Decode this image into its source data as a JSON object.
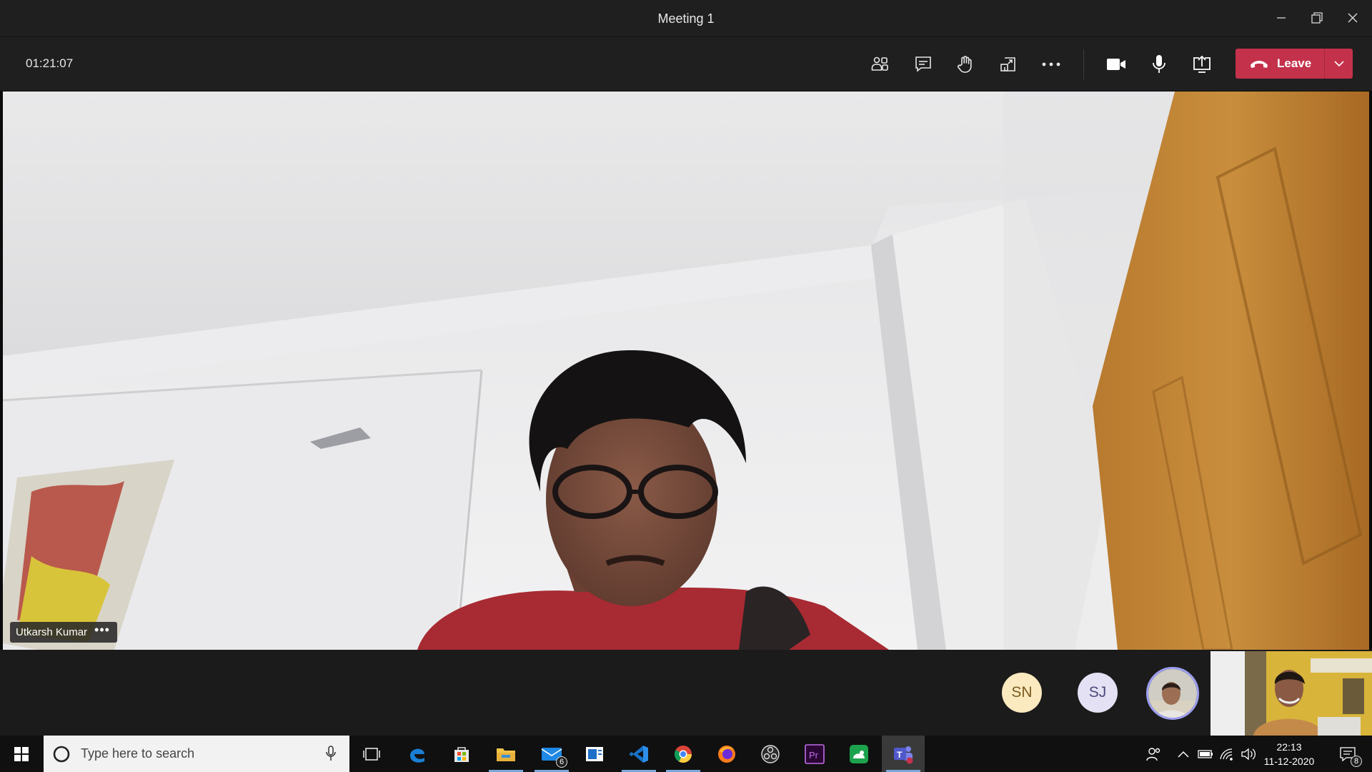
{
  "window": {
    "title": "Meeting 1"
  },
  "controls": {
    "timer": "01:21:07",
    "leave_label": "Leave"
  },
  "main_video": {
    "participant_name": "Utkarsh Kumar",
    "more_label": "•••"
  },
  "participants": [
    {
      "initials": "SN",
      "color": "#fbe9c0"
    },
    {
      "initials": "SJ",
      "color": "#e3e1f3"
    }
  ],
  "taskbar": {
    "search_placeholder": "Type here to search",
    "mail_badge": "6",
    "time": "22:13",
    "date": "11-12-2020",
    "notifications_badge": "8"
  },
  "colors": {
    "leave": "#c4314b",
    "accent": "#9c9ef0",
    "bar": "#1f1f1f"
  },
  "icons": [
    "minimize-icon",
    "restore-icon",
    "close-icon",
    "participants-icon",
    "chat-icon",
    "raise-hand-icon",
    "room-view-icon",
    "more-icon",
    "camera-icon",
    "microphone-icon",
    "share-screen-icon",
    "phone-hangup-icon",
    "chevron-down-icon",
    "windows-logo-icon",
    "cortana-icon",
    "microphone-icon",
    "task-view-icon",
    "edge-icon",
    "store-icon",
    "file-explorer-icon",
    "mail-icon",
    "news-icon",
    "vscode-icon",
    "chrome-icon",
    "firefox-icon",
    "obs-icon",
    "premiere-icon",
    "app-icon",
    "teams-icon",
    "people-icon",
    "chevron-up-icon",
    "battery-icon",
    "wifi-icon",
    "speaker-icon",
    "notifications-icon"
  ]
}
